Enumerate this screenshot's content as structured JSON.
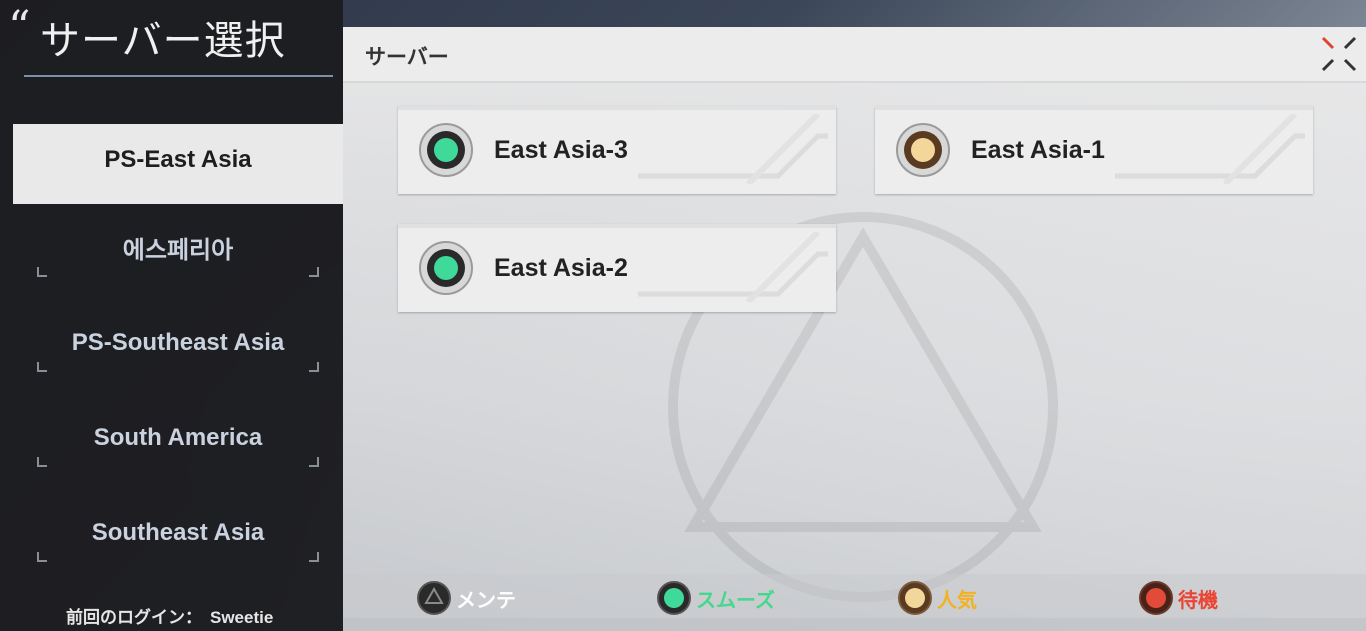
{
  "screen_title": "サーバー選択",
  "regions": [
    {
      "label": "PS-East Asia",
      "active": true
    },
    {
      "label": "에스페리아",
      "active": false
    },
    {
      "label": "PS-Southeast Asia",
      "active": false
    },
    {
      "label": "South America",
      "active": false
    },
    {
      "label": "Southeast Asia",
      "active": false
    }
  ],
  "last_login": {
    "label": "前回のログイン：",
    "user": "Sweetie"
  },
  "server_panel": {
    "header": "サーバー"
  },
  "servers": [
    {
      "name": "East Asia-3",
      "status": "smooth",
      "status_color": "#3fd99a"
    },
    {
      "name": "East Asia-1",
      "status": "popular",
      "status_color": "#f3d79a"
    },
    {
      "name": "East Asia-2",
      "status": "smooth",
      "status_color": "#3fd99a"
    }
  ],
  "legend": [
    {
      "label": "メンテ",
      "color": "#1a1a1a",
      "text_color": "#ffffff"
    },
    {
      "label": "スムーズ",
      "color": "#3fd99a",
      "text_color": "#44d88c"
    },
    {
      "label": "人気",
      "color": "#f3d79a",
      "text_color": "#f2b21e"
    },
    {
      "label": "待機",
      "color": "#e24a3a",
      "text_color": "#ea4434"
    }
  ],
  "icons": {
    "close": "close-x-icon"
  }
}
